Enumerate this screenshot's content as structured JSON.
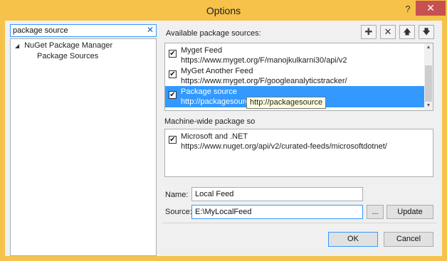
{
  "window": {
    "title": "Options",
    "help_glyph": "?",
    "close_glyph": "✕"
  },
  "search": {
    "value": "package source",
    "clear_glyph": "✕"
  },
  "tree": {
    "parent": "NuGet Package Manager",
    "child": "Package Sources",
    "expand_glyph": "◢"
  },
  "available": {
    "label": "Available package sources:",
    "toolbar": {
      "add_glyph": "✚",
      "remove_glyph": "✕",
      "up_glyph": "🡅",
      "down_glyph": "🡇"
    },
    "items": [
      {
        "name": "Myget Feed",
        "url": "https://www.myget.org/F/manojkulkarni30/api/v2",
        "checked": true,
        "selected": false
      },
      {
        "name": "MyGet Another Feed",
        "url": "https://www.myget.org/F/googleanalyticstracker/",
        "checked": true,
        "selected": false
      },
      {
        "name": "Package source",
        "url": "http://packagesource",
        "checked": true,
        "selected": true
      }
    ],
    "scroll_up_glyph": "▲",
    "scroll_down_glyph": "▼"
  },
  "machine_wide": {
    "label": "Machine-wide package so",
    "items": [
      {
        "name": "Microsoft and .NET",
        "url": "https://www.nuget.org/api/v2/curated-feeds/microsoftdotnet/",
        "checked": true
      }
    ]
  },
  "tooltip": "http://packagesource",
  "form": {
    "name_label": "Name:",
    "name_value": "Local Feed",
    "source_label": "Source:",
    "source_value": "E:\\MyLocalFeed",
    "browse_label": "...",
    "update_label": "Update"
  },
  "footer": {
    "ok_label": "OK",
    "cancel_label": "Cancel"
  },
  "check_glyph": "✔"
}
